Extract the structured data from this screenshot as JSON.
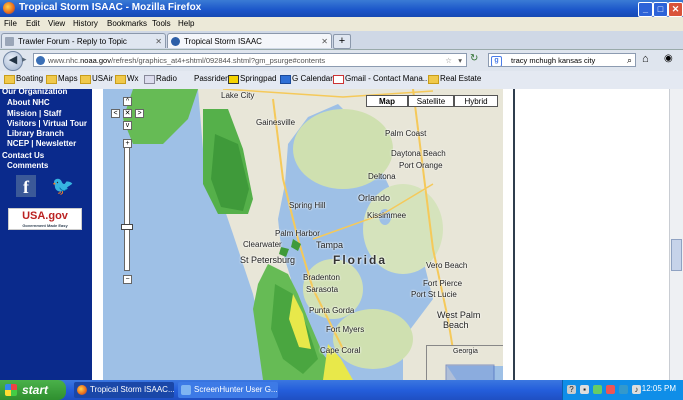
{
  "window": {
    "title": "Tropical Storm ISAAC - Mozilla Firefox",
    "controls": [
      "_",
      "□",
      "✕"
    ]
  },
  "menu": [
    "File",
    "Edit",
    "View",
    "History",
    "Bookmarks",
    "Tools",
    "Help"
  ],
  "tabs": [
    {
      "label": "Trawler Forum - Reply to Topic",
      "close": "✕",
      "active": false
    },
    {
      "label": "Tropical Storm ISAAC",
      "close": "✕",
      "active": true
    }
  ],
  "new_tab_label": "+",
  "nav": {
    "back": "◀",
    "forward": "▸",
    "url_prefix": "www.nhc.",
    "url_domain": "noaa.gov",
    "url_rest": "/refresh/graphics_at4+shtml/092844.shtml?gm_psurge#contents",
    "star": "☆",
    "dropdown": "▾",
    "refresh": "↻",
    "search_engine": "g",
    "search_text": "tracy mchugh kansas city",
    "search_icon": "⌕",
    "home_icon": "⌂",
    "view_icon": "◉"
  },
  "bookmarks": [
    {
      "label": "Boating",
      "icon": "folder-icon"
    },
    {
      "label": "Maps",
      "icon": "folder-icon"
    },
    {
      "label": "USAir",
      "icon": "folder-icon"
    },
    {
      "label": "Wx",
      "icon": "folder-icon"
    },
    {
      "label": "Radio",
      "icon": "radio-icon"
    },
    {
      "label": "Passrider",
      "icon": "none"
    },
    {
      "label": "Springpad",
      "icon": "springpad-icon"
    },
    {
      "label": "G Calendar",
      "icon": "calendar-icon"
    },
    {
      "label": "Gmail - Contact Mana...",
      "icon": "gmail-icon"
    },
    {
      "label": "Real Estate",
      "icon": "folder-icon"
    }
  ],
  "sidebar": {
    "org_heading": "Our Organization",
    "links": [
      "About NHC",
      "Mission | Staff",
      "Visitors | Virtual Tour",
      "Library Branch",
      "NCEP | Newsletter"
    ],
    "contact_heading": "Contact Us",
    "comments": "Comments",
    "facebook": "f",
    "twitter": "🐦",
    "usagov": "USA.gov",
    "usagov_tag": "Government Made Easy"
  },
  "map": {
    "types": [
      "Map",
      "Satellite",
      "Hybrid"
    ],
    "selected_type": "Map",
    "pan": {
      "up": "^",
      "left": "<",
      "center": "✕",
      "right": ">",
      "down": "v"
    },
    "zoom_in": "+",
    "zoom_out": "−",
    "zoom_level_fraction": 0.65,
    "overview_label": "Georgia",
    "labels": {
      "lake_city": "Lake City",
      "gainesville": "Gainesville",
      "palm_coast": "Palm Coast",
      "daytona": "Daytona Beach",
      "port_orange": "Port Orange",
      "deltona": "Deltona",
      "orlando": "Orlando",
      "kissimmee": "Kissimmee",
      "spring_hill": "Spring Hill",
      "palm_harbor": "Palm Harbor",
      "clearwater": "Clearwater",
      "tampa": "Tampa",
      "st_pete": "St Petersburg",
      "florida": "Florida",
      "bradenton": "Bradenton",
      "sarasota": "Sarasota",
      "vero_beach": "Vero Beach",
      "fort_pierce": "Fort Pierce",
      "port_st_lucie": "Port St Lucie",
      "punta_gorda": "Punta Gorda",
      "fort_myers": "Fort Myers",
      "cape_coral": "Cape Coral",
      "west_palm": "West Palm",
      "beach": "Beach"
    }
  },
  "taskbar": {
    "start": "start",
    "tasks": [
      "Tropical Storm ISAAC...",
      "ScreenHunter User G..."
    ],
    "clock": "12:05 PM"
  }
}
